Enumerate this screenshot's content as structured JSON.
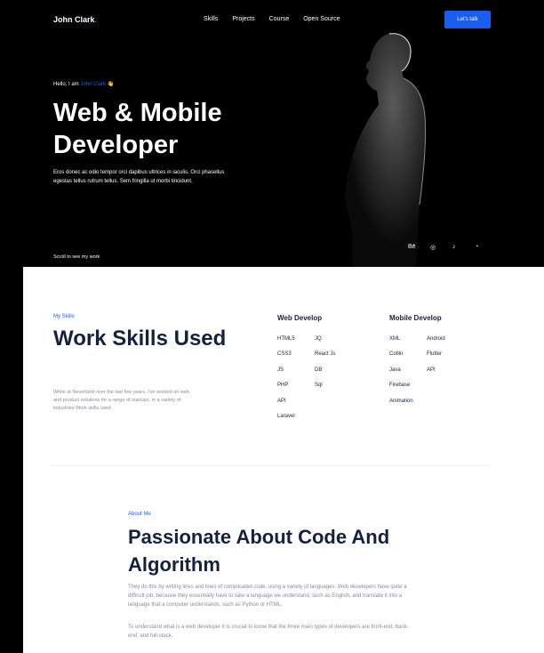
{
  "header": {
    "logo": "John Clark",
    "logo_dot": ".",
    "nav": [
      "Skills",
      "Projects",
      "Course",
      "Open Source"
    ],
    "cta": "Let's talk"
  },
  "hero": {
    "greeting": "Hello, I am ",
    "name": "John Clark",
    "wave": "👋",
    "title": "Web & Mobile Developer",
    "description": "Eros donec ac odio tempor orci dapibus ultrices in iaculis. Orci phasellus egestas tellus rutrum tellus. Sem fringilla ut morbi tincidunt.",
    "scroll_hint": "Scroll to see my work",
    "socials": [
      "Bē",
      "◎",
      "♪",
      "◔"
    ]
  },
  "skills": {
    "label": "My Skills",
    "title": "Work Skills Used",
    "description": "While at Neverland over the last few years, I've worked on web and product solutions for a range of startups, in a variety of industries.Work skills used",
    "web": {
      "heading": "Web Develop",
      "col1": [
        "HTML5",
        "CSS3",
        "JS",
        "PHP",
        "API",
        "Laravel"
      ],
      "col2": [
        "JQ",
        "React Js",
        "DB",
        "Sql"
      ]
    },
    "mobile": {
      "heading": "Mobile Develop",
      "col1": [
        "XML",
        "Cotlin",
        "Java",
        "Firebase",
        "Animation"
      ],
      "col2": [
        "Android",
        "Flutter",
        "API"
      ]
    }
  },
  "about": {
    "label": "About Me",
    "title": "Passionate About Code And Algorithm",
    "p1": "They do this by writing lines and lines of complicated code, using a variety of languages. Web developers have quite a difficult job, because they essentially have to take a language we understand, such as English, and translate it into a language that a computer understands, such as Python or HTML.",
    "p2": "To understand what is a web developer it is crucial to know that the three main types of developers are front-end, back-end, and full-stack."
  },
  "colors": {
    "accent": "#1a5ef0",
    "heading": "#16213e",
    "muted": "#8a8a9a"
  }
}
